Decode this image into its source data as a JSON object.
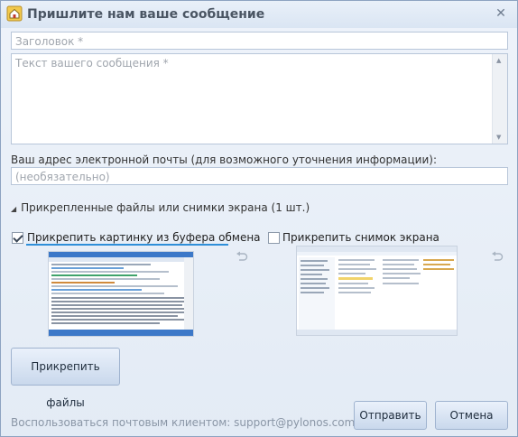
{
  "window": {
    "title": "Пришлите нам ваше сообщение",
    "close_glyph": "✕",
    "app_icon": "home-icon"
  },
  "form": {
    "subject_placeholder": "Заголовок *",
    "message_placeholder": "Текст вашего сообщения *",
    "email_label": "Ваш адрес электронной почты (для возможного уточнения информации):",
    "email_placeholder": "(необязательно)"
  },
  "attachments": {
    "header": "Прикрепленные файлы или снимки экрана (1 шт.)",
    "clipboard": {
      "label": "Прикрепить картинку из буфера обмена",
      "checked": true
    },
    "screenshot": {
      "label": "Прикрепить снимок экрана",
      "checked": false
    },
    "undo_icon": "undo-icon"
  },
  "buttons": {
    "attach_files": "Прикрепить файлы",
    "send": "Отправить",
    "cancel": "Отмена"
  },
  "footer": {
    "mail_client_link": "Воспользоваться почтовым клиентом: support@pylonos.com"
  },
  "colors": {
    "accent": "#2f8fd9",
    "window_bg": "#e3ebf5",
    "border": "#8da3c1"
  }
}
